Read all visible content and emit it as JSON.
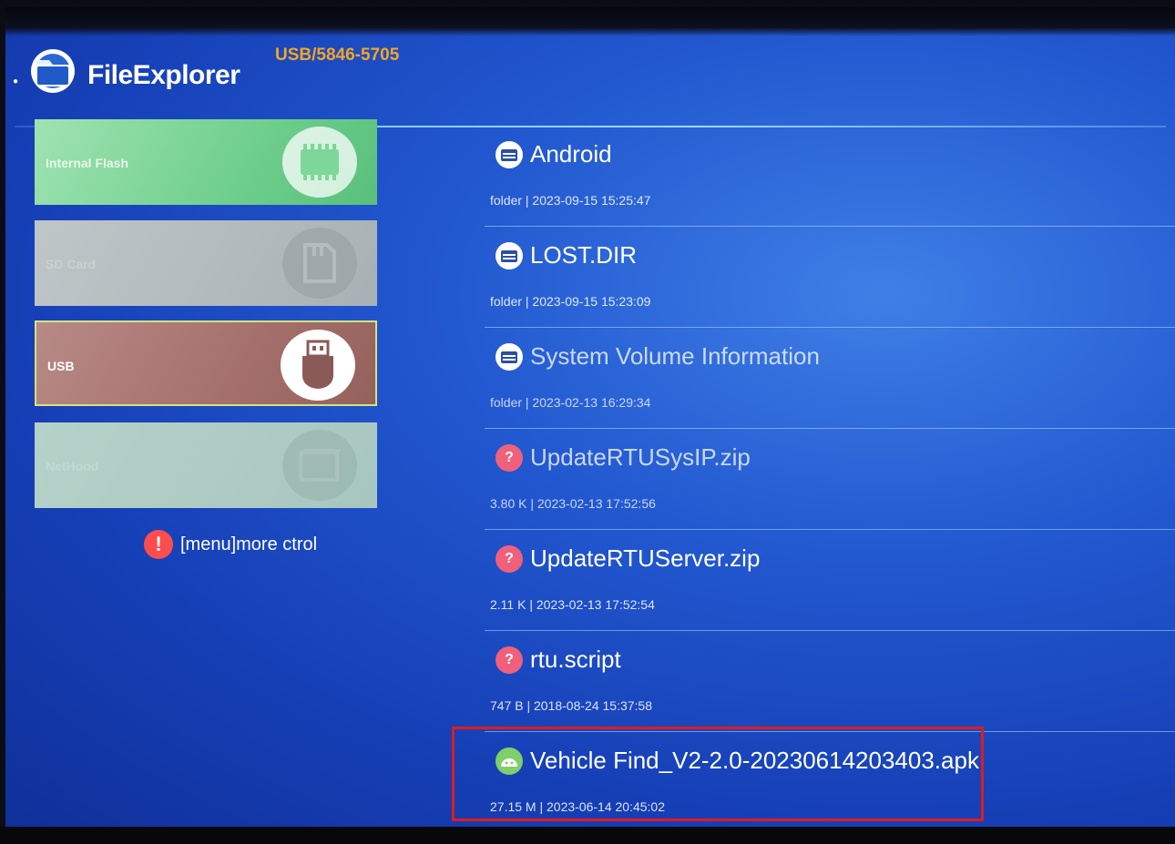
{
  "header": {
    "app_title": "FileExplorer",
    "current_path": "USB/5846-5705",
    "app_icon": "folder-icon"
  },
  "devices": [
    {
      "label": "Internal Flash",
      "icon": "memory-chip-icon",
      "selected": false
    },
    {
      "label": "SD Card",
      "icon": "sd-card-icon",
      "selected": false
    },
    {
      "label": "USB",
      "icon": "usb-drive-icon",
      "selected": true
    },
    {
      "label": "NetHood",
      "icon": "network-icon",
      "selected": false
    }
  ],
  "hint": {
    "text": "[menu]more ctrol",
    "icon": "alert-icon"
  },
  "files": [
    {
      "name": "Android",
      "meta": "folder | 2023-09-15 15:25:47",
      "icon": "folder-icon"
    },
    {
      "name": "LOST.DIR",
      "meta": "folder | 2023-09-15 15:23:09",
      "icon": "folder-icon"
    },
    {
      "name": "System Volume Information",
      "meta": "folder | 2023-02-13 16:29:34",
      "icon": "folder-icon"
    },
    {
      "name": "UpdateRTUSysIP.zip",
      "meta": "3.80 K | 2023-02-13 17:52:56",
      "icon": "unknown-file-icon"
    },
    {
      "name": "UpdateRTUServer.zip",
      "meta": "2.11 K | 2023-02-13 17:52:54",
      "icon": "unknown-file-icon"
    },
    {
      "name": "rtu.script",
      "meta": "747 B | 2018-08-24 15:37:58",
      "icon": "unknown-file-icon"
    },
    {
      "name": "Vehicle Find_V2-2.0-20230614203403.apk",
      "meta": "27.15 M | 2023-06-14 20:45:02",
      "icon": "apk-icon"
    }
  ],
  "colors": {
    "accent_path": "#f5a623",
    "highlight_border": "#e11b1b",
    "background": "#1d4cc4"
  }
}
